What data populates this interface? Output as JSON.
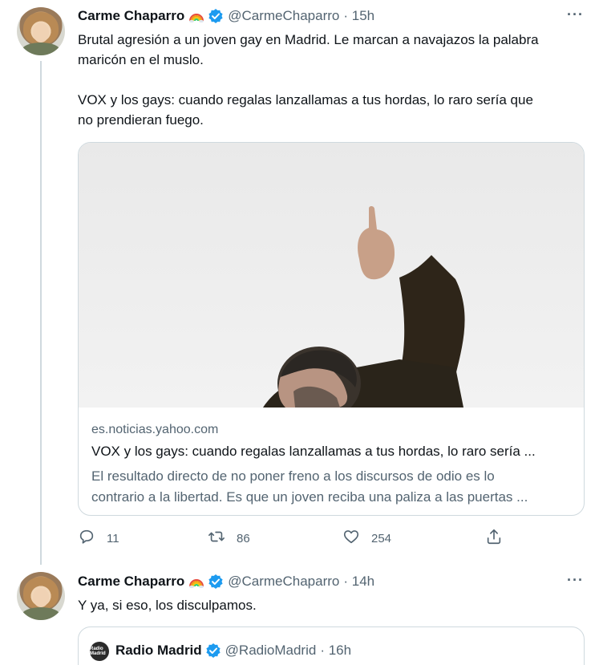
{
  "tweets": [
    {
      "author_name": "Carme Chaparro",
      "handle": "@CarmeChaparro",
      "time": "· 15h",
      "more_label": "···",
      "text_lines": [
        "Brutal agresión a un joven gay en Madrid. Le marcan a navajazos la palabra",
        "maricón en el muslo.",
        "VOX y los gays: cuando regalas lanzallamas a tus hordas, lo raro sería que",
        "no prendieran fuego."
      ],
      "card": {
        "domain": "es.noticias.yahoo.com",
        "title": "VOX y los gays: cuando regalas lanzallamas a tus hordas, lo raro sería ...",
        "desc_lines": [
          "El resultado directo de no poner freno a los discursos de odio es lo",
          "contrario a la libertad. Es que un joven reciba una paliza a las puertas ..."
        ]
      },
      "actions": {
        "replies": "11",
        "retweets": "86",
        "likes": "254"
      }
    },
    {
      "author_name": "Carme Chaparro",
      "handle": "@CarmeChaparro",
      "time": "· 14h",
      "more_label": "···",
      "text_lines": [
        "Y ya, si eso, los disculpamos."
      ],
      "quote": {
        "avatar_text": "Radio Madrid",
        "author_name": "Radio Madrid",
        "handle": "@RadioMadrid",
        "time": "· 16h"
      }
    }
  ],
  "colors": {
    "text": "#0f1419",
    "secondary": "#536471",
    "verified": "#1d9bf0",
    "border": "#cfd9de"
  },
  "icons": [
    "rainbow-icon",
    "verified-icon",
    "more-icon",
    "reply-icon",
    "retweet-icon",
    "like-icon",
    "share-icon"
  ]
}
